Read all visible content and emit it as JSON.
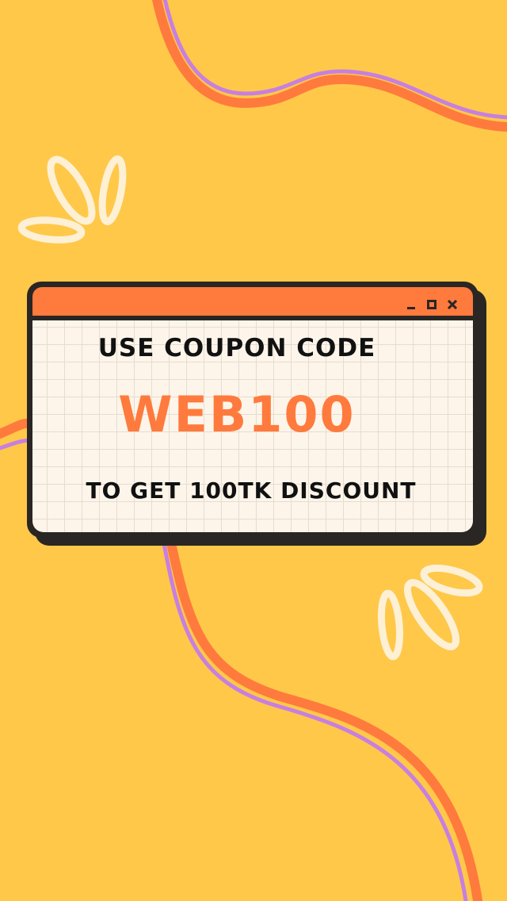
{
  "window": {
    "controls": [
      "minimize-icon",
      "maximize-icon",
      "close-icon"
    ],
    "line1": "USE COUPON CODE",
    "code": "WEB100",
    "line3": "TO GET 100TK DISCOUNT"
  },
  "colors": {
    "background": "#FFC849",
    "accent": "#FF7A3D",
    "stripe": "#C77FE0",
    "cream": "#FDF0D5",
    "dark": "#2a2624"
  }
}
